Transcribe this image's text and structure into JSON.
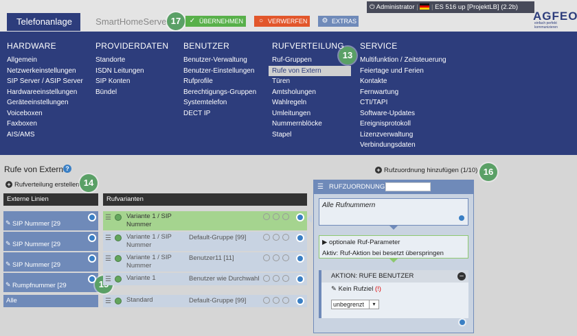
{
  "tabs": {
    "active": "Telefonanlage",
    "inactive": "SmartHomeServer"
  },
  "toolbar": {
    "apply": "ÜBERNEHMEN",
    "discard": "VERWERFEN",
    "extras": "EXTRAS"
  },
  "badges": {
    "b17": "17",
    "b13": "13",
    "b14": "14",
    "b15": "15",
    "b16": "16"
  },
  "userbar": {
    "user": "Administrator",
    "device": "ES 516 up [ProjektLB] (2.2b)"
  },
  "logo": {
    "name": "AGFEO",
    "tagline": "einfach perfekt kommunizieren"
  },
  "nav": {
    "hardware": {
      "title": "HARDWARE",
      "items": [
        "Allgemein",
        "Netzwerkeinstellungen",
        "SIP Server / ASIP Server",
        "Hardwareeinstellungen",
        "Geräteeinstellungen",
        "Voiceboxen",
        "Faxboxen",
        "AIS/AMS"
      ]
    },
    "provider": {
      "title": "PROVIDERDATEN",
      "items": [
        "Standorte",
        "ISDN Leitungen",
        "SIP Konten",
        "Bündel"
      ]
    },
    "benutzer": {
      "title": "BENUTZER",
      "items": [
        "Benutzer-Verwaltung",
        "Benutzer-Einstellungen",
        "Rufprofile",
        "Berechtigungs-Gruppen",
        "Systemtelefon",
        "DECT IP"
      ]
    },
    "rufverteilung": {
      "title": "RUFVERTEILUNG",
      "items": [
        "Ruf-Gruppen",
        "Rufe von Extern",
        "Türen",
        "Amtsholungen",
        "Wahlregeln",
        "Umleitungen",
        "Nummernblöcke",
        "Stapel"
      ]
    },
    "service": {
      "title": "SERVICE",
      "items": [
        "Multifunktion / Zeitsteuerung",
        "Feiertage und Ferien",
        "Kontakte",
        "Fernwartung",
        "CTI/TAPI",
        "Software-Updates",
        "Ereignisprotokoll",
        "Lizenzverwaltung",
        "Verbindungsdaten"
      ]
    }
  },
  "page": {
    "title": "Rufe von Extern",
    "create_link": "Rufverteilung erstellen",
    "add_link": "Rufzuordnung hinzufügen",
    "add_count": "(1/10)"
  },
  "externe": {
    "header": "Externe Linien",
    "items": [
      "SIP Nummer [29",
      "SIP Nummer [29",
      "SIP Nummer [29",
      "Rumpfnummer [29"
    ],
    "all": "Alle"
  },
  "varianten": {
    "header": "Rufvarianten",
    "rows": [
      {
        "name1": "Variante 1 / SIP",
        "name2": "Nummer",
        "group": ""
      },
      {
        "name1": "Variante 1 / SIP",
        "name2": "Nummer",
        "group": "Default-Gruppe [99]"
      },
      {
        "name1": "Variante 1 / SIP",
        "name2": "Nummer",
        "group": "Benutzer11 [11]"
      },
      {
        "name1": "Variante 1",
        "name2": "",
        "group": "Benutzer wie Durchwahl"
      },
      {
        "name1": "Standard",
        "name2": "",
        "group": "Default-Gruppe [99]"
      }
    ]
  },
  "zuordnung": {
    "title": "RUFZUORDNUNG",
    "all_numbers": "Alle Rufnummern",
    "optional": "optionale Ruf-Parameter",
    "active_text": "Aktiv: Ruf-Aktion bei besetzt überspringen",
    "action_title": "AKTION: RUFE BENUTZER",
    "no_target": "Kein Rufziel",
    "warn": "(!)",
    "select_value": "unbegrenzt"
  },
  "colors": {
    "nav": "#2d3d7c",
    "accent_green": "#5aa066",
    "apply": "#58b04a",
    "discard": "#e2562b",
    "extras": "#6f8ab9"
  }
}
